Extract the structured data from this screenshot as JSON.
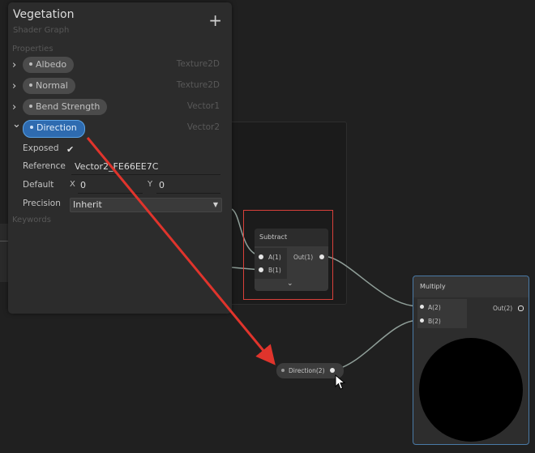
{
  "blackboard": {
    "title": "Vegetation",
    "subtitle": "Shader Graph",
    "add_label": "+",
    "properties_header": "Properties",
    "keywords_header": "Keywords",
    "properties": [
      {
        "name": "Albedo",
        "type": "Texture2D",
        "chevron": "›"
      },
      {
        "name": "Normal",
        "type": "Texture2D",
        "chevron": "›"
      },
      {
        "name": "Bend Strength",
        "type": "Vector1",
        "chevron": "›"
      },
      {
        "name": "Direction",
        "type": "Vector2",
        "chevron": "⌄"
      }
    ],
    "expanded": {
      "exposed_label": "Exposed",
      "exposed_check": "✔",
      "reference_label": "Reference",
      "reference_value": "Vector2_FE66EE7C",
      "default_label": "Default",
      "x_label": "X",
      "x_value": "0",
      "y_label": "Y",
      "y_value": "0",
      "precision_label": "Precision",
      "precision_value": "Inherit"
    }
  },
  "nodes": {
    "subtract": {
      "title": "Subtract",
      "inputs": [
        "A(1)",
        "B(1)"
      ],
      "output": "Out(1)",
      "expander": "⌄"
    },
    "multiply": {
      "title": "Multiply",
      "inputs": [
        "A(2)",
        "B(2)"
      ],
      "output": "Out(2)"
    },
    "property_node": {
      "label": "Direction(2)"
    }
  },
  "colors": {
    "selection_blue": "#2e6bb0",
    "annotation_red": "#d9403a",
    "selected_node_border": "#4a7aa6"
  }
}
